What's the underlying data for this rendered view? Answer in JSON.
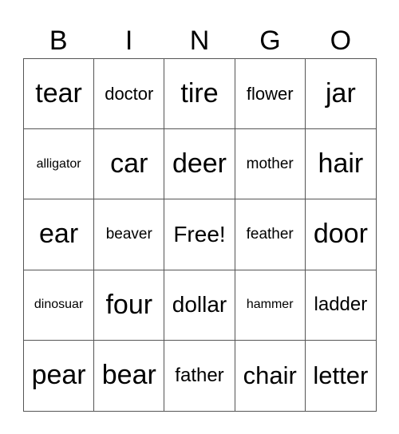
{
  "header": [
    "B",
    "I",
    "N",
    "G",
    "O"
  ],
  "cells": [
    [
      "tear",
      "doctor",
      "tire",
      "flower",
      "jar"
    ],
    [
      "alligator",
      "car",
      "deer",
      "mother",
      "hair"
    ],
    [
      "ear",
      "beaver",
      "Free!",
      "feather",
      "door"
    ],
    [
      "dinosuar",
      "four",
      "dollar",
      "hammer",
      "ladder"
    ],
    [
      "pear",
      "bear",
      "father",
      "chair",
      "letter"
    ]
  ]
}
